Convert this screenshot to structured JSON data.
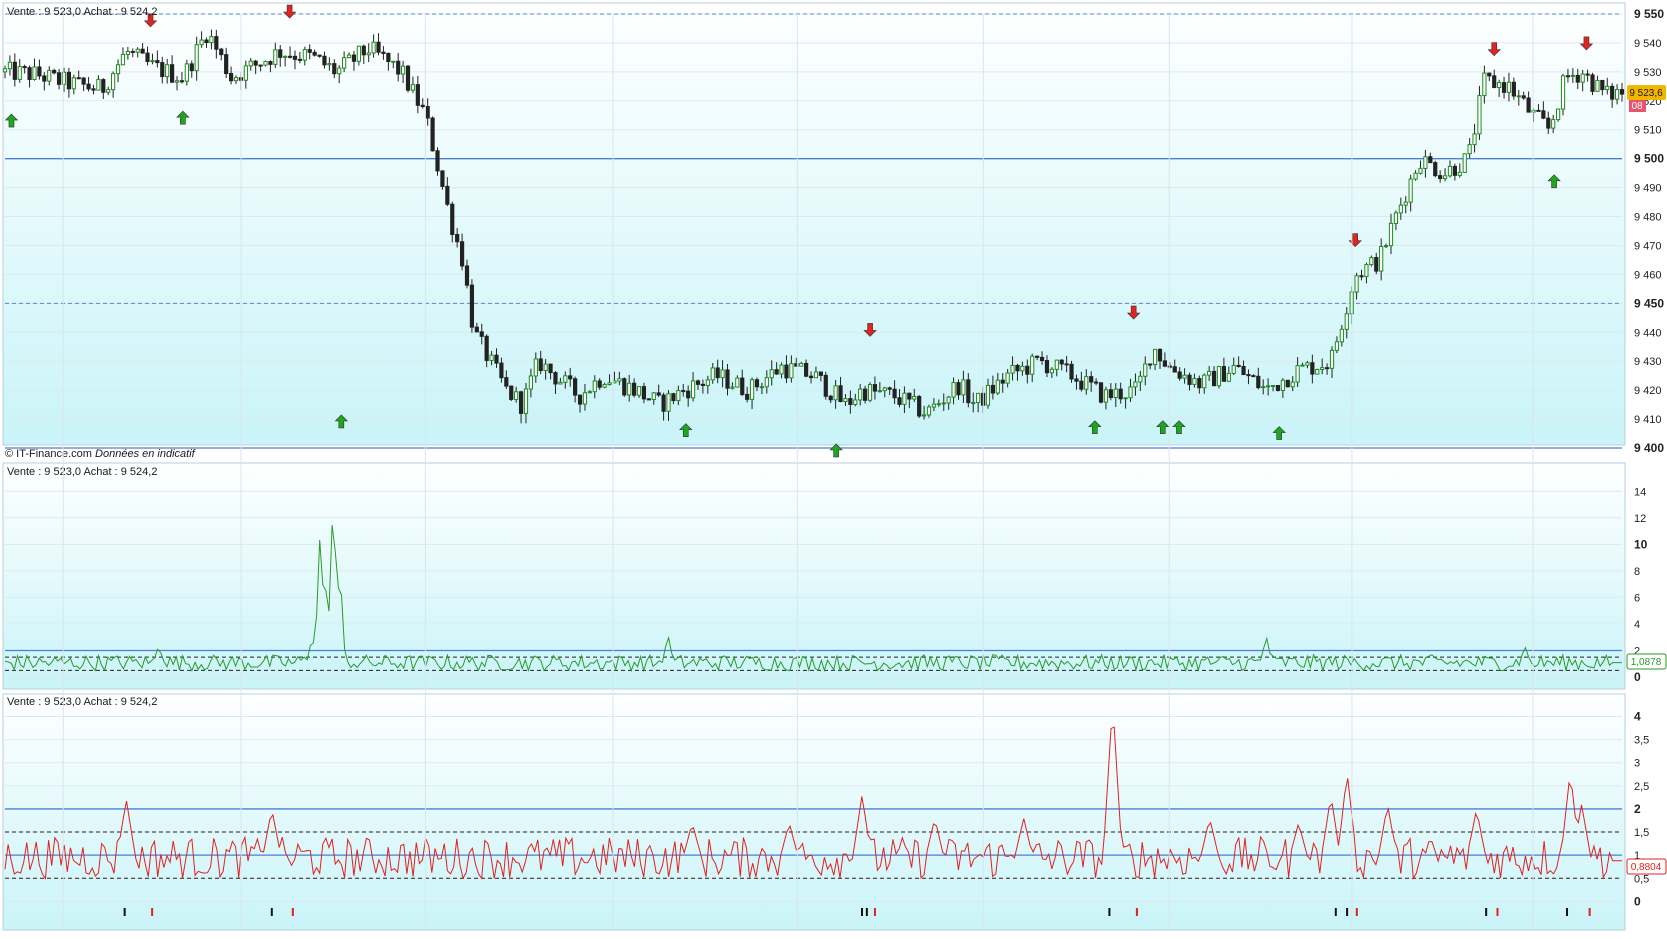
{
  "colors": {
    "up_candle": "#1e8a1e",
    "down_candle": "#222222",
    "buy_arrow": "#1fa51f",
    "sell_arrow": "#e02424",
    "hline_solid": "#4a7fd4",
    "hline_dashed": "#5b87c6",
    "line_panel2": "#2a9a2a",
    "line_panel3": "#e02020",
    "bg_top": "#ffffff",
    "bg_bottom": "#c9f4f8",
    "price_badge": "#f2b600",
    "value_badge_fill": "#ffffff",
    "value2_border": "#2a9a2a",
    "value3_border": "#e02020"
  },
  "panels": [
    {
      "id": "price",
      "quote": "Vente : 9 523,0 Achat : 9 524,2",
      "credit": "© IT-Finance.com",
      "credit_note": "Données en indicatif",
      "price_badge": "9 523,6",
      "small_badge": "08",
      "chart_data": {
        "type": "candlestick",
        "ylim": [
          9400,
          9550
        ],
        "yticks": [
          "9 550",
          "9 540",
          "9 530",
          "9 520",
          "9 510",
          "9 500",
          "9 490",
          "9 480",
          "9 470",
          "9 460",
          "9 450",
          "9 440",
          "9 430",
          "9 420",
          "9 410",
          "9 400"
        ],
        "major_ticks": [
          "9 550",
          "9 500",
          "9 450",
          "9 400"
        ],
        "hlines": [
          {
            "value": 9550,
            "style": "dashed"
          },
          {
            "value": 9500,
            "style": "solid"
          },
          {
            "value": 9450,
            "style": "dashed"
          },
          {
            "value": 9400,
            "style": "solid"
          }
        ],
        "close_profile": [
          [
            0,
            9530
          ],
          [
            0.02,
            9529
          ],
          [
            0.04,
            9526
          ],
          [
            0.06,
            9524
          ],
          [
            0.075,
            9537
          ],
          [
            0.09,
            9532
          ],
          [
            0.11,
            9528
          ],
          [
            0.125,
            9544
          ],
          [
            0.14,
            9528
          ],
          [
            0.17,
            9537
          ],
          [
            0.19,
            9535
          ],
          [
            0.205,
            9530
          ],
          [
            0.225,
            9538
          ],
          [
            0.245,
            9530
          ],
          [
            0.26,
            9515
          ],
          [
            0.275,
            9480
          ],
          [
            0.283,
            9465
          ],
          [
            0.29,
            9440
          ],
          [
            0.3,
            9430
          ],
          [
            0.31,
            9420
          ],
          [
            0.32,
            9415
          ],
          [
            0.33,
            9430
          ],
          [
            0.34,
            9425
          ],
          [
            0.355,
            9418
          ],
          [
            0.37,
            9425
          ],
          [
            0.39,
            9420
          ],
          [
            0.405,
            9415
          ],
          [
            0.42,
            9420
          ],
          [
            0.44,
            9425
          ],
          [
            0.46,
            9420
          ],
          [
            0.48,
            9428
          ],
          [
            0.5,
            9425
          ],
          [
            0.52,
            9415
          ],
          [
            0.53,
            9420
          ],
          [
            0.55,
            9418
          ],
          [
            0.57,
            9412
          ],
          [
            0.59,
            9422
          ],
          [
            0.6,
            9415
          ],
          [
            0.62,
            9425
          ],
          [
            0.64,
            9430
          ],
          [
            0.66,
            9425
          ],
          [
            0.68,
            9418
          ],
          [
            0.7,
            9420
          ],
          [
            0.71,
            9435
          ],
          [
            0.72,
            9428
          ],
          [
            0.74,
            9422
          ],
          [
            0.76,
            9428
          ],
          [
            0.78,
            9420
          ],
          [
            0.8,
            9427
          ],
          [
            0.82,
            9430
          ],
          [
            0.835,
            9460
          ],
          [
            0.85,
            9465
          ],
          [
            0.86,
            9480
          ],
          [
            0.875,
            9500
          ],
          [
            0.89,
            9495
          ],
          [
            0.905,
            9500
          ],
          [
            0.915,
            9527
          ],
          [
            0.93,
            9525
          ],
          [
            0.945,
            9515
          ],
          [
            0.955,
            9510
          ],
          [
            0.965,
            9528
          ],
          [
            0.975,
            9530
          ],
          [
            0.99,
            9522
          ],
          [
            1.0,
            9523
          ]
        ],
        "signals": [
          {
            "kind": "buy",
            "t": 0.004,
            "price": 9513
          },
          {
            "kind": "sell",
            "t": 0.09,
            "price": 9548
          },
          {
            "kind": "buy",
            "t": 0.11,
            "price": 9514
          },
          {
            "kind": "sell",
            "t": 0.176,
            "price": 9551
          },
          {
            "kind": "buy",
            "t": 0.208,
            "price": 9409
          },
          {
            "kind": "buy",
            "t": 0.421,
            "price": 9406
          },
          {
            "kind": "buy",
            "t": 0.514,
            "price": 9399
          },
          {
            "kind": "sell",
            "t": 0.535,
            "price": 9441
          },
          {
            "kind": "sell",
            "t": 0.698,
            "price": 9447
          },
          {
            "kind": "buy",
            "t": 0.674,
            "price": 9407
          },
          {
            "kind": "buy",
            "t": 0.716,
            "price": 9407
          },
          {
            "kind": "buy",
            "t": 0.726,
            "price": 9407
          },
          {
            "kind": "buy",
            "t": 0.788,
            "price": 9405
          },
          {
            "kind": "sell",
            "t": 0.835,
            "price": 9472
          },
          {
            "kind": "sell",
            "t": 0.921,
            "price": 9538
          },
          {
            "kind": "buy",
            "t": 0.958,
            "price": 9492
          },
          {
            "kind": "sell",
            "t": 0.978,
            "price": 9540
          }
        ]
      }
    },
    {
      "id": "ind1",
      "quote": "Vente : 9 523,0 Achat : 9 524,2",
      "value_badge": "1,0878",
      "chart_data": {
        "type": "line",
        "ylim": [
          0,
          15
        ],
        "yticks": [
          "14",
          "12",
          "10",
          "8",
          "6",
          "4",
          "2",
          "0"
        ],
        "major_ticks": [
          "10",
          "0"
        ],
        "hlines": [
          {
            "value": 2,
            "style": "solid"
          },
          {
            "value": 1.5,
            "style": "dashed"
          },
          {
            "value": 0.5,
            "style": "dashed"
          }
        ],
        "spikes": [
          [
            0.185,
            1.5
          ],
          [
            0.19,
            3.0
          ],
          [
            0.195,
            11.5
          ],
          [
            0.199,
            7.5
          ],
          [
            0.203,
            14.0
          ],
          [
            0.207,
            8.5
          ],
          [
            0.212,
            0.3
          ],
          [
            0.095,
            2.3
          ],
          [
            0.41,
            3.2
          ],
          [
            0.78,
            3.1
          ],
          [
            0.94,
            2.3
          ]
        ],
        "baseline": 1.08,
        "last": 1.0878
      }
    },
    {
      "id": "ind2",
      "quote": "Vente : 9 523,0 Achat : 9 524,2",
      "value_badge": "0,8804",
      "chart_data": {
        "type": "line",
        "ylim": [
          -0.1,
          4.4
        ],
        "yticks": [
          "4",
          "3,5",
          "3",
          "2,5",
          "2",
          "1,5",
          "1",
          "0,5",
          "0"
        ],
        "major_ticks": [
          "4",
          "2",
          "0"
        ],
        "hlines": [
          {
            "value": 2,
            "style": "solid"
          },
          {
            "value": 1.5,
            "style": "dashed"
          },
          {
            "value": 1,
            "style": "solid"
          },
          {
            "value": 0.5,
            "style": "dashed"
          }
        ],
        "spikes": [
          [
            0.075,
            2.2
          ],
          [
            0.165,
            2.0
          ],
          [
            0.425,
            1.7
          ],
          [
            0.485,
            1.7
          ],
          [
            0.53,
            2.3
          ],
          [
            0.575,
            1.8
          ],
          [
            0.63,
            1.8
          ],
          [
            0.685,
            4.3
          ],
          [
            0.745,
            1.8
          ],
          [
            0.8,
            1.7
          ],
          [
            0.82,
            2.3
          ],
          [
            0.83,
            2.8
          ],
          [
            0.855,
            2.1
          ],
          [
            0.91,
            2.0
          ],
          [
            0.968,
            2.8
          ],
          [
            0.975,
            2.1
          ]
        ],
        "baseline": 0.9,
        "last": 0.8804,
        "marks": [
          {
            "t": 0.074,
            "color": "#111"
          },
          {
            "t": 0.091,
            "color": "#e02020"
          },
          {
            "t": 0.165,
            "color": "#111"
          },
          {
            "t": 0.178,
            "color": "#e02020"
          },
          {
            "t": 0.53,
            "color": "#111"
          },
          {
            "t": 0.533,
            "color": "#111"
          },
          {
            "t": 0.538,
            "color": "#e02020"
          },
          {
            "t": 0.683,
            "color": "#111"
          },
          {
            "t": 0.7,
            "color": "#e02020"
          },
          {
            "t": 0.823,
            "color": "#111"
          },
          {
            "t": 0.83,
            "color": "#111"
          },
          {
            "t": 0.836,
            "color": "#e02020"
          },
          {
            "t": 0.916,
            "color": "#111"
          },
          {
            "t": 0.923,
            "color": "#e02020"
          },
          {
            "t": 0.966,
            "color": "#111"
          },
          {
            "t": 0.98,
            "color": "#e02020"
          }
        ]
      }
    }
  ]
}
